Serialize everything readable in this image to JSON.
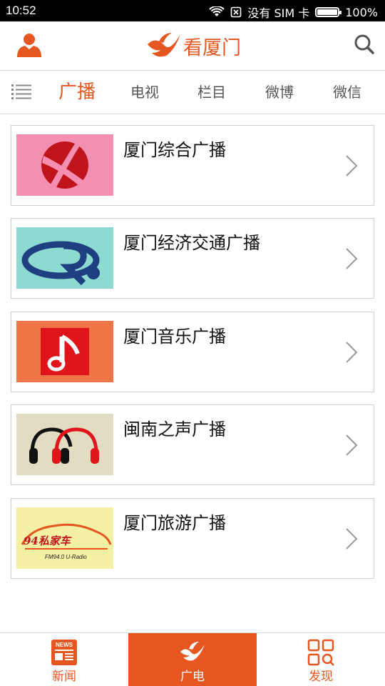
{
  "status_bar": {
    "time": "10:52",
    "sim_text": "没有 SIM 卡",
    "battery_text": "100%",
    "battery_level": 1.0
  },
  "header": {
    "title": "看厦门",
    "icons": [
      "user-icon",
      "brand-logo-icon",
      "search-icon"
    ]
  },
  "tabs": {
    "items": [
      "广播",
      "电视",
      "栏目",
      "微博",
      "微信"
    ],
    "active": "广播"
  },
  "stations": [
    {
      "name": "厦门综合广播",
      "thumb_bg": "#f48fb1",
      "icon": "xmrs-logo-icon"
    },
    {
      "name": "厦门经济交通广播",
      "thumb_bg": "#8ddad0",
      "icon": "economic-traffic-logo-icon"
    },
    {
      "name": "厦门音乐广播",
      "thumb_bg": "#ef7446",
      "icon": "music-note-logo-icon"
    },
    {
      "name": "闽南之声广播",
      "thumb_bg": "#e2dcc3",
      "icon": "headphones-logo-icon"
    },
    {
      "name": "厦门旅游广播",
      "thumb_bg": "#f4f0a4",
      "icon": "private-car-logo-icon",
      "logo_text_main": "94私家车",
      "logo_text_sub": "FM94.0 U-Radio"
    }
  ],
  "bottom_nav": {
    "items": [
      {
        "label": "新闻",
        "icon": "news-icon",
        "icon_text": "NEWS"
      },
      {
        "label": "广电",
        "icon": "broadcast-icon"
      },
      {
        "label": "发现",
        "icon": "discover-grid-icon"
      }
    ],
    "active": "广电"
  },
  "colors": {
    "accent": "#e55620",
    "text": "#111111",
    "border": "#cfcfcf"
  }
}
